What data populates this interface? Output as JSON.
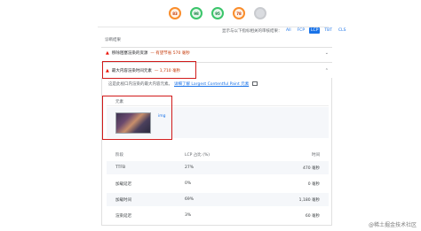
{
  "scores": [
    {
      "value": "83",
      "status": "average"
    },
    {
      "value": "98",
      "status": "pass"
    },
    {
      "value": "95",
      "status": "pass"
    },
    {
      "value": "78",
      "status": "average"
    },
    {
      "value": "",
      "status": "pwa"
    }
  ],
  "colors": {
    "fail": "#eb0f00",
    "average": "#fa8d2b",
    "pass": "#3bc56a",
    "link": "#1a73e8",
    "highlight": "#d11a1a"
  },
  "filter": {
    "label": "显示与以下指标相关的审核结果：",
    "chips": [
      {
        "label": "All",
        "active": false
      },
      {
        "label": "FCP",
        "active": false
      },
      {
        "label": "LCP",
        "active": true
      },
      {
        "label": "TBT",
        "active": false
      },
      {
        "label": "CLS",
        "active": false
      }
    ]
  },
  "diagnostics_title": "诊断结果",
  "audits": [
    {
      "title": "移除阻塞渲染的资源",
      "savings": "— 有望节省 570 毫秒"
    },
    {
      "title": "最大内容渲染时间元素",
      "savings": "— 1,710 毫秒"
    }
  ],
  "details": {
    "description": "这是此视口内渲染的最大内容元素。",
    "link": "详细了解 Largest Contentful Paint 元素",
    "element_header": "元素",
    "element_label": "img",
    "columns": [
      "阶段",
      "LCP 占比 (%)",
      "时间"
    ],
    "rows": [
      {
        "phase": "TTFB",
        "pct": "27%",
        "time": "470 毫秒"
      },
      {
        "phase": "加载延迟",
        "pct": "0%",
        "time": "0 毫秒"
      },
      {
        "phase": "加载时间",
        "pct": "69%",
        "time": "1,180 毫秒"
      },
      {
        "phase": "渲染延迟",
        "pct": "3%",
        "time": "60 毫秒"
      }
    ]
  },
  "watermark": "@稀土掘金技术社区"
}
